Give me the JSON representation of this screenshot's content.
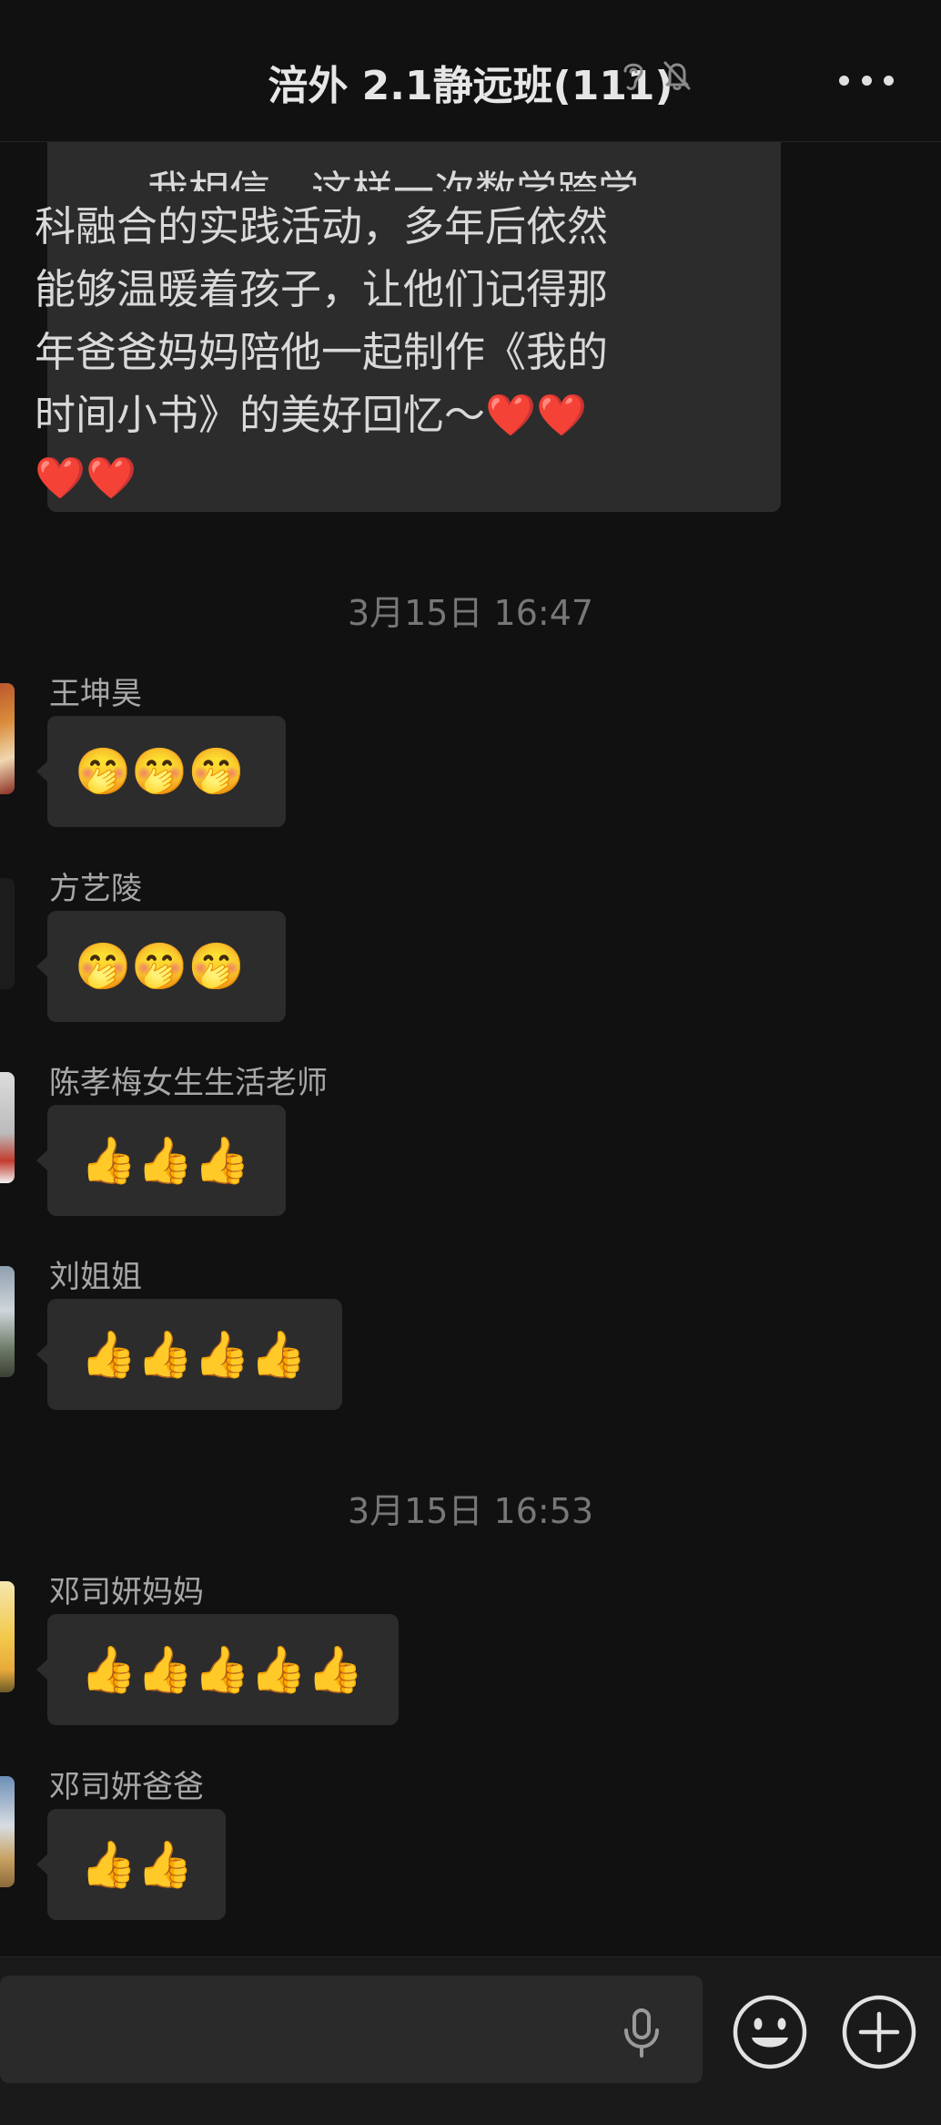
{
  "header": {
    "title": "涪外 2.1静远班(111)",
    "icons": [
      "ear-icon",
      "mute-bell-icon"
    ],
    "more_icon": "more-dots-icon"
  },
  "messages": {
    "partial_text": {
      "lines": [
        "我相信，这样一次数学跨学",
        "科融合的实践活动，多年后依然",
        "能够温暖着孩子，让他们记得那",
        "年爸爸妈妈陪他一起制作《我的",
        "时间小书》的美好回忆～❤️❤️",
        "❤️❤️"
      ]
    },
    "time_1": "3月15日 16:47",
    "time_2": "3月15日 16:53",
    "items": [
      {
        "sender": "王坤昊",
        "emojis": "🤭🤭🤭"
      },
      {
        "sender": "方艺陵",
        "emojis": "🤭🤭🤭"
      },
      {
        "sender": "陈孝梅女生生活老师",
        "emojis": "👍👍👍"
      },
      {
        "sender": "刘姐姐",
        "emojis": "👍👍👍👍"
      },
      {
        "sender": "邓司妍妈妈",
        "emojis": "👍👍👍👍👍"
      },
      {
        "sender": "邓司妍爸爸",
        "emojis": "👍👍"
      }
    ]
  },
  "input_bar": {
    "value": "",
    "icons": [
      "microphone-icon",
      "emoji-face-icon",
      "plus-circle-icon"
    ]
  },
  "colors": {
    "background": "#111111",
    "bubble": "#2c2c2c",
    "timestamp": "#777777"
  }
}
